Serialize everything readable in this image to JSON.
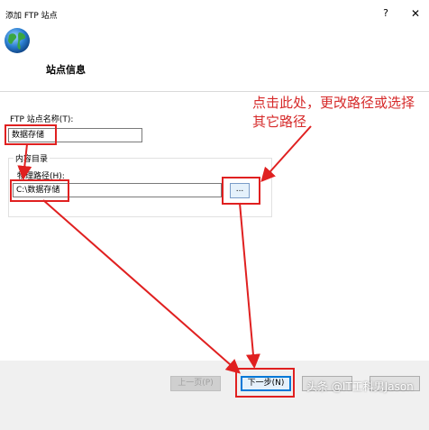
{
  "window": {
    "title": "添加 FTP 站点",
    "help_glyph": "?",
    "close_glyph": "✕"
  },
  "header": {
    "title": "站点信息",
    "icon": "globe-icon"
  },
  "annotation": {
    "text": "点击此处，更改路径或选择其它路径",
    "color": "#d62a2a"
  },
  "form": {
    "site_name_label": "FTP 站点名称(T):",
    "site_name_value": "数据存储",
    "content_dir_label": "内容目录",
    "physical_path_label": "物理路径(H):",
    "physical_path_value": "C:\\数据存储",
    "browse_label": "..."
  },
  "footer": {
    "prev_label": "上一页(P)",
    "next_label": "下一步(N)",
    "finish_label": "",
    "cancel_label": ""
  },
  "watermark": "头条 @IT工科男Jason",
  "colors": {
    "highlight": "#e02020",
    "accent": "#0078d7"
  }
}
